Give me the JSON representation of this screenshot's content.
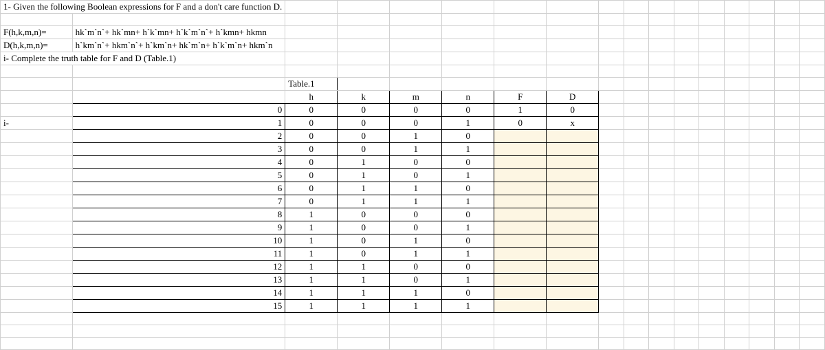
{
  "problem": {
    "q1": "1-  Given the following Boolean expressions for F and a don't care function D.",
    "F_label": "F(h,k,m,n)=",
    "F_expr": "hk`m`n`+ hk`mn+ h`k`mn+ h`k`m`n`+ h`kmn+ hkmn",
    "D_label": "D(h,k,m,n)=",
    "D_expr": "h`km`n`+ hkm`n`+ h`km`n+ hk`m`n+ h`k`m`n+ hkm`n",
    "task_i": "i-  Complete the truth table for F and D (Table.1)"
  },
  "table": {
    "caption": "Table.1",
    "row_label_i": "i-",
    "headers": {
      "h": "h",
      "k": "k",
      "m": "m",
      "n": "n",
      "F": "F",
      "D": "D"
    },
    "rows": [
      {
        "idx": "0",
        "h": "0",
        "k": "0",
        "m": "0",
        "n": "0",
        "F": "1",
        "D": "0"
      },
      {
        "idx": "1",
        "h": "0",
        "k": "0",
        "m": "0",
        "n": "1",
        "F": "0",
        "D": "x"
      },
      {
        "idx": "2",
        "h": "0",
        "k": "0",
        "m": "1",
        "n": "0",
        "F": "",
        "D": ""
      },
      {
        "idx": "3",
        "h": "0",
        "k": "0",
        "m": "1",
        "n": "1",
        "F": "",
        "D": ""
      },
      {
        "idx": "4",
        "h": "0",
        "k": "1",
        "m": "0",
        "n": "0",
        "F": "",
        "D": ""
      },
      {
        "idx": "5",
        "h": "0",
        "k": "1",
        "m": "0",
        "n": "1",
        "F": "",
        "D": ""
      },
      {
        "idx": "6",
        "h": "0",
        "k": "1",
        "m": "1",
        "n": "0",
        "F": "",
        "D": ""
      },
      {
        "idx": "7",
        "h": "0",
        "k": "1",
        "m": "1",
        "n": "1",
        "F": "",
        "D": ""
      },
      {
        "idx": "8",
        "h": "1",
        "k": "0",
        "m": "0",
        "n": "0",
        "F": "",
        "D": ""
      },
      {
        "idx": "9",
        "h": "1",
        "k": "0",
        "m": "0",
        "n": "1",
        "F": "",
        "D": ""
      },
      {
        "idx": "10",
        "h": "1",
        "k": "0",
        "m": "1",
        "n": "0",
        "F": "",
        "D": ""
      },
      {
        "idx": "11",
        "h": "1",
        "k": "0",
        "m": "1",
        "n": "1",
        "F": "",
        "D": ""
      },
      {
        "idx": "12",
        "h": "1",
        "k": "1",
        "m": "0",
        "n": "0",
        "F": "",
        "D": ""
      },
      {
        "idx": "13",
        "h": "1",
        "k": "1",
        "m": "0",
        "n": "1",
        "F": "",
        "D": ""
      },
      {
        "idx": "14",
        "h": "1",
        "k": "1",
        "m": "1",
        "n": "0",
        "F": "",
        "D": ""
      },
      {
        "idx": "15",
        "h": "1",
        "k": "1",
        "m": "1",
        "n": "1",
        "F": "",
        "D": ""
      }
    ]
  }
}
